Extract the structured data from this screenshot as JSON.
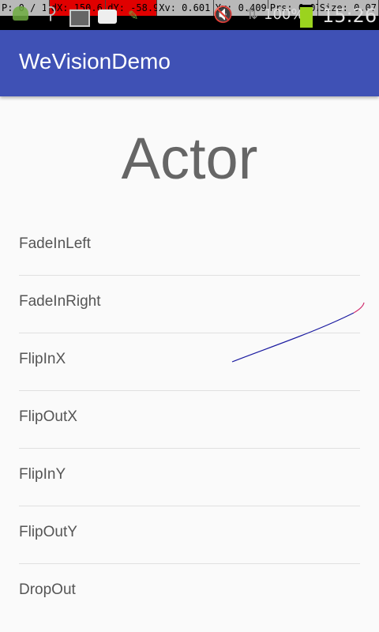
{
  "status_bar": {
    "pointer_info": {
      "p": "P: 0 / 1",
      "dx": "dX: 150.6",
      "dy": "dY: -58.9",
      "xv": "Xv: 0.601",
      "yv": "Yv: 0.409",
      "prs": "Prs: 0.07",
      "size": "Size: 0.07"
    },
    "icons": [
      "android-icon",
      "usb-icon",
      "sd-card-icon",
      "debug-bot-icon",
      "pen-icon",
      "mute-icon",
      "signal-icon"
    ],
    "battery_percent": "100%",
    "time": "15:26"
  },
  "app_bar": {
    "title": "WeVisionDemo",
    "color": "#3f51b5"
  },
  "main": {
    "heading": "Actor",
    "items": [
      {
        "label": "FadeInLeft"
      },
      {
        "label": "FadeInRight"
      },
      {
        "label": "FlipInX"
      },
      {
        "label": "FlipOutX"
      },
      {
        "label": "FlipInY"
      },
      {
        "label": "FlipOutY"
      },
      {
        "label": "DropOut"
      }
    ]
  }
}
